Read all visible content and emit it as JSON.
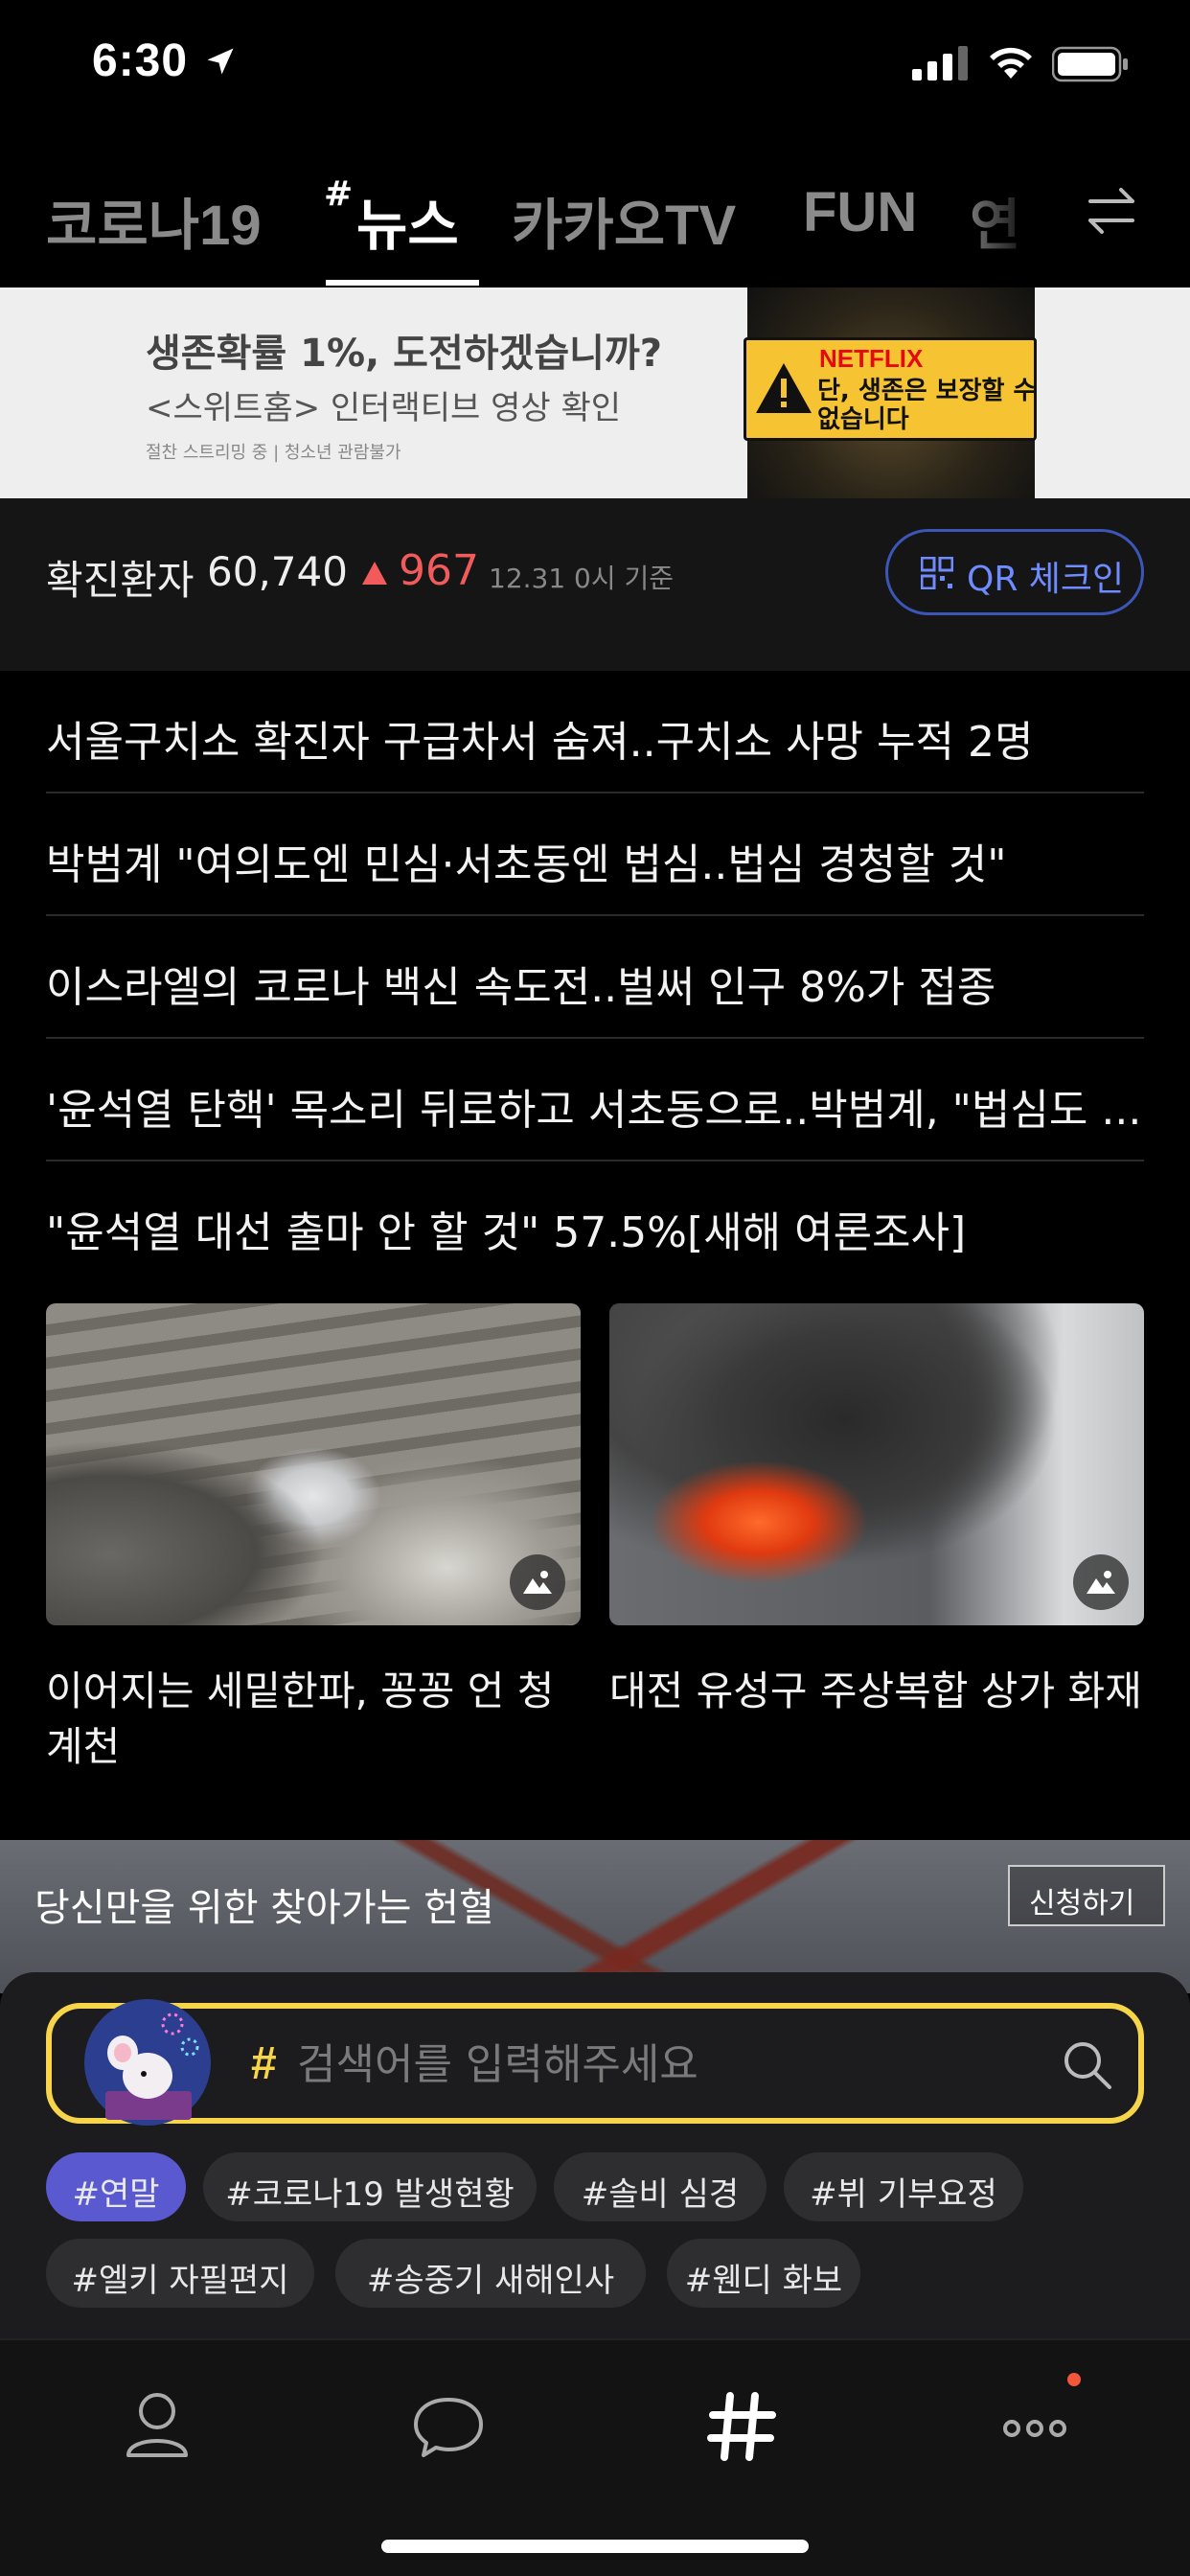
{
  "status_bar": {
    "time": "6:30"
  },
  "tabs": {
    "items": [
      {
        "label": "코로나19"
      },
      {
        "label": "뉴스",
        "prefix": "#"
      },
      {
        "label": "카카오TV"
      },
      {
        "label": "FUN"
      },
      {
        "label": "연"
      }
    ],
    "active_index": 1
  },
  "ad": {
    "headline": "생존확률 1%, 도전하겠습니까?",
    "subline": "<스위트홈> 인터랙티브 영상 확인",
    "fineprint": "절찬 스트리밍 중 | 청소년 관람불가",
    "brand": "NETFLIX",
    "badge_text": "단, 생존은 보장할 수 없습니다"
  },
  "covid": {
    "label": "확진환자",
    "count": "60,740",
    "delta": "967",
    "date": "12.31 0시 기준",
    "qr_label": "QR 체크인"
  },
  "news": {
    "headlines": [
      "서울구치소 확진자 구급차서 숨져..구치소 사망 누적 2명",
      "박범계 \"여의도엔 민심·서초동엔 법심..법심 경청할 것\"",
      "이스라엘의 코로나 백신 속도전..벌써 인구 8%가 접종",
      "'윤석열 탄핵' 목소리 뒤로하고 서초동으로..박범계, \"법심도 ...",
      "\"윤석열 대선 출마 안 할 것\" 57.5%[새해 여론조사]"
    ],
    "photos": [
      {
        "caption": "이어지는 세밑한파, 꽁꽁 언 청계천",
        "icon": "gallery-icon"
      },
      {
        "caption": "대전 유성구 주상복합 상가 화재",
        "icon": "gallery-icon"
      }
    ]
  },
  "donation": {
    "text": "당신만을 위한 찾아가는 헌혈",
    "apply_label": "신청하기"
  },
  "search": {
    "hash": "#",
    "placeholder": "검색어를 입력해주세요",
    "hashtags": [
      "#연말",
      "#코로나19 발생현황",
      "#솔비 심경",
      "#뷔 기부요정",
      "#엘키 자필편지",
      "#송중기 새해인사",
      "#웬디 화보"
    ]
  },
  "bottom_nav": {
    "items": [
      {
        "icon": "person-icon"
      },
      {
        "icon": "chat-bubble-icon"
      },
      {
        "icon": "hash-icon",
        "active": true
      },
      {
        "icon": "more-icon",
        "notification_dot": true
      }
    ]
  },
  "colors": {
    "accent_yellow": "#f7d54a",
    "delta_red": "#f25b5b",
    "qr_blue": "#6f8bff",
    "hashtag_selected": "#5a59d0"
  }
}
